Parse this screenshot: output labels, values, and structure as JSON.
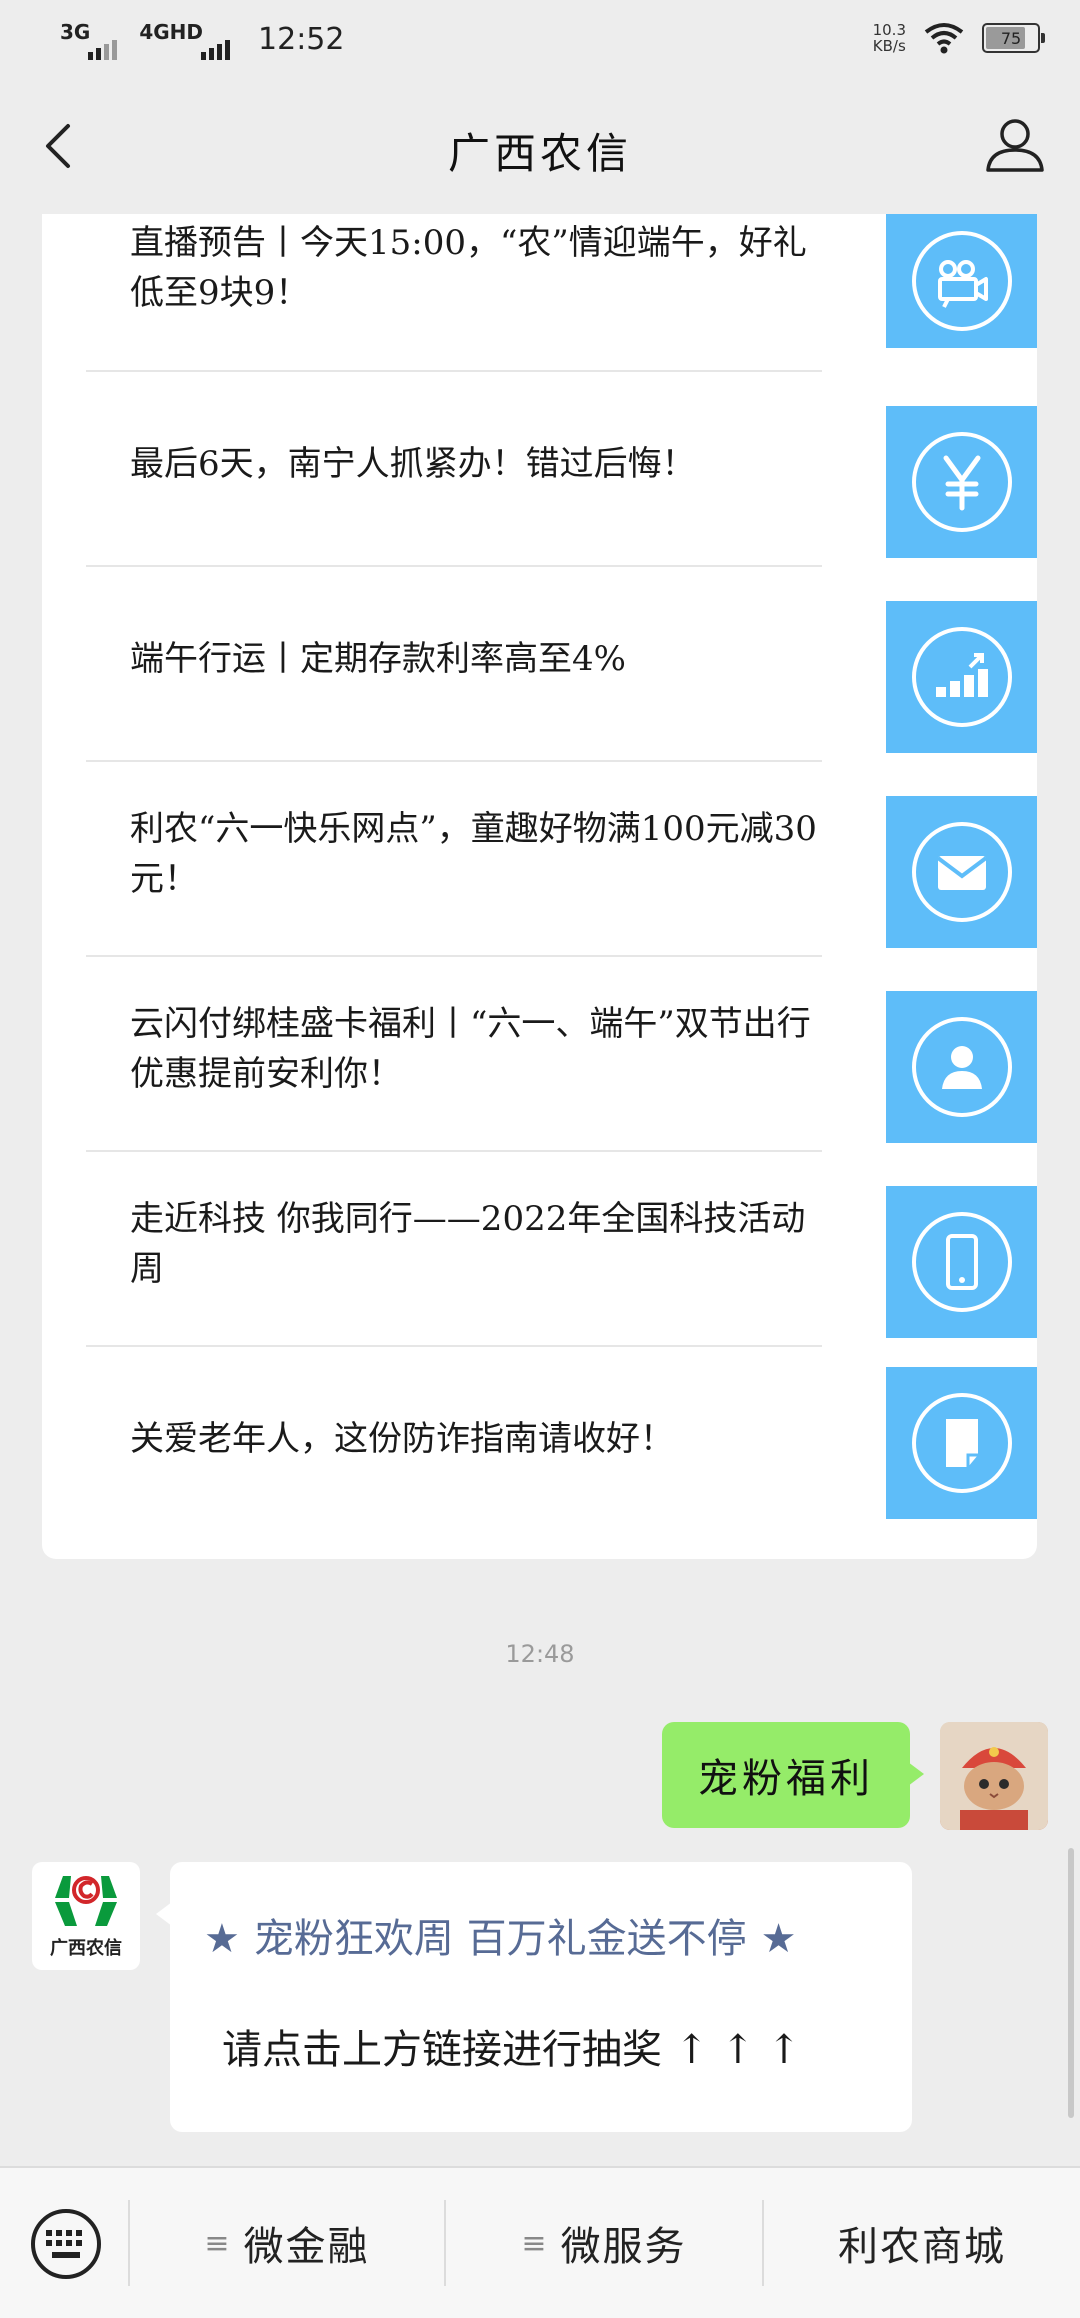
{
  "status_bar": {
    "signal_1": "3G",
    "signal_2": "4GHD",
    "time": "12:52",
    "net_speed_value": "10.3",
    "net_speed_unit": "KB/s",
    "battery": "75"
  },
  "header": {
    "title": "广西农信"
  },
  "articles": [
    {
      "title": "直播预告丨今天15:00，“农”情迎端午，好礼低至9块9！",
      "icon": "video-camera-icon"
    },
    {
      "title": "最后6天，南宁人抓紧办！错过后悔！",
      "icon": "yen-icon"
    },
    {
      "title": "端午行运丨定期存款利率高至4%",
      "icon": "growth-chart-icon"
    },
    {
      "title": "利农“六一快乐网点”，童趣好物满100元减30元！",
      "icon": "mail-icon"
    },
    {
      "title": "云闪付绑桂盛卡福利丨“六一、端午”双节出行优惠提前安利你！",
      "icon": "user-icon"
    },
    {
      "title": "走近科技 你我同行——2022年全国科技活动周",
      "icon": "phone-icon"
    },
    {
      "title": "关爱老年人，这份防诈指南请收好！",
      "icon": "document-icon"
    }
  ],
  "chat": {
    "time": "12:48",
    "outgoing_message": "宠粉福利",
    "bank_avatar_label": "广西农信",
    "incoming": {
      "star_left": "★",
      "link_title": "宠粉狂欢周 百万礼金送不停",
      "star_right": "★",
      "body": "请点击上方链接进行抽奖 ↑ ↑ ↑"
    }
  },
  "bottom_menu": {
    "items": [
      "微金融",
      "微服务",
      "利农商城"
    ],
    "hamburger": "≡"
  },
  "colors": {
    "thumb_blue": "#5ebdf9",
    "bubble_green": "#95ec69",
    "link_blue": "#576b95",
    "logo_green": "#0a9a3c",
    "logo_red": "#d2262a"
  }
}
